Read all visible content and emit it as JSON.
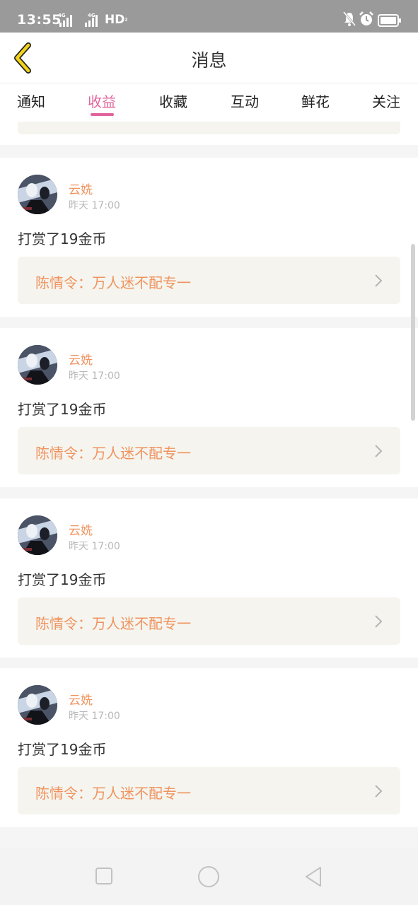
{
  "status_bar": {
    "time": "13:55",
    "signal1_label": "4G",
    "signal2_label": "4G",
    "hd_label": "HD",
    "hd_sub": "2",
    "icons": [
      "mute-bell-icon",
      "alarm-icon",
      "battery-icon"
    ]
  },
  "header": {
    "back_icon": "chevron-left-icon",
    "title": "消息"
  },
  "tabs": [
    {
      "label": "通知",
      "active": false
    },
    {
      "label": "收益",
      "active": true
    },
    {
      "label": "收藏",
      "active": false
    },
    {
      "label": "互动",
      "active": false
    },
    {
      "label": "鲜花",
      "active": false
    },
    {
      "label": "关注",
      "active": false
    }
  ],
  "messages": [
    {
      "user": "云姺",
      "time": "昨天 17:00",
      "action": "打赏了19金币",
      "book": "陈情令：万人迷不配专一"
    },
    {
      "user": "云姺",
      "time": "昨天 17:00",
      "action": "打赏了19金币",
      "book": "陈情令：万人迷不配专一"
    },
    {
      "user": "云姺",
      "time": "昨天 17:00",
      "action": "打赏了19金币",
      "book": "陈情令：万人迷不配专一"
    },
    {
      "user": "云姺",
      "time": "昨天 17:00",
      "action": "打赏了19金币",
      "book": "陈情令：万人迷不配专一"
    }
  ],
  "colors": {
    "accent": "#e1649e",
    "name": "#f0935f",
    "book_bg": "#f5f4ee",
    "back_arrow": "#f2d21a"
  },
  "nav_bar": {
    "icons": [
      "recent-apps-icon",
      "home-icon",
      "back-triangle-icon"
    ]
  }
}
